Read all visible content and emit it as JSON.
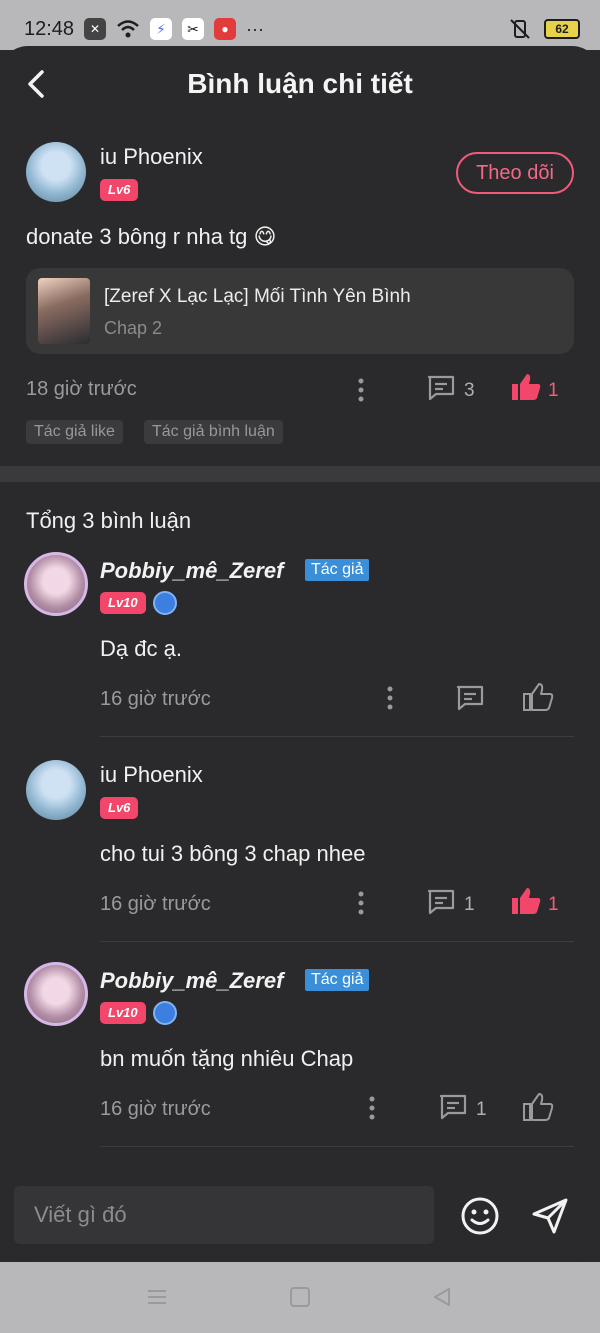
{
  "status_bar": {
    "time": "12:48",
    "battery": "62"
  },
  "header": {
    "title": "Bình luận chi tiết"
  },
  "main_comment": {
    "username": "iu Phoenix",
    "level": "Lv6",
    "follow_label": "Theo dõi",
    "text": "donate 3 bông r nha tg 😋",
    "story": {
      "title": "[Zeref X Lạc Lạc] Mối Tình Yên Bình",
      "chapter": "Chap 2"
    },
    "time": "18 giờ trước",
    "reply_count": "3",
    "like_count": "1",
    "tags": [
      "Tác giả like",
      "Tác giả bình luận"
    ]
  },
  "total_label": "Tổng 3 bình luận",
  "replies": [
    {
      "username": "Pobbiy_mê_Zeref",
      "badge": "Tác giả",
      "level": "Lv10",
      "text": "Dạ đc ạ.",
      "time": "16 giờ trước",
      "reply_count": "",
      "like_count": "",
      "liked": false
    },
    {
      "username": "iu Phoenix",
      "badge": "",
      "level": "Lv6",
      "text": "cho tui 3 bông 3 chap nhee",
      "time": "16 giờ trước",
      "reply_count": "1",
      "like_count": "1",
      "liked": true
    },
    {
      "username": "Pobbiy_mê_Zeref",
      "badge": "Tác giả",
      "level": "Lv10",
      "text": "bn muốn tặng nhiêu Chap",
      "time": "16 giờ trước",
      "reply_count": "1",
      "like_count": "",
      "liked": false
    }
  ],
  "input": {
    "placeholder": "Viết gì đó"
  },
  "colors": {
    "accent": "#f2476b",
    "author_badge": "#3a8fd8",
    "background": "#2a2a2c"
  }
}
